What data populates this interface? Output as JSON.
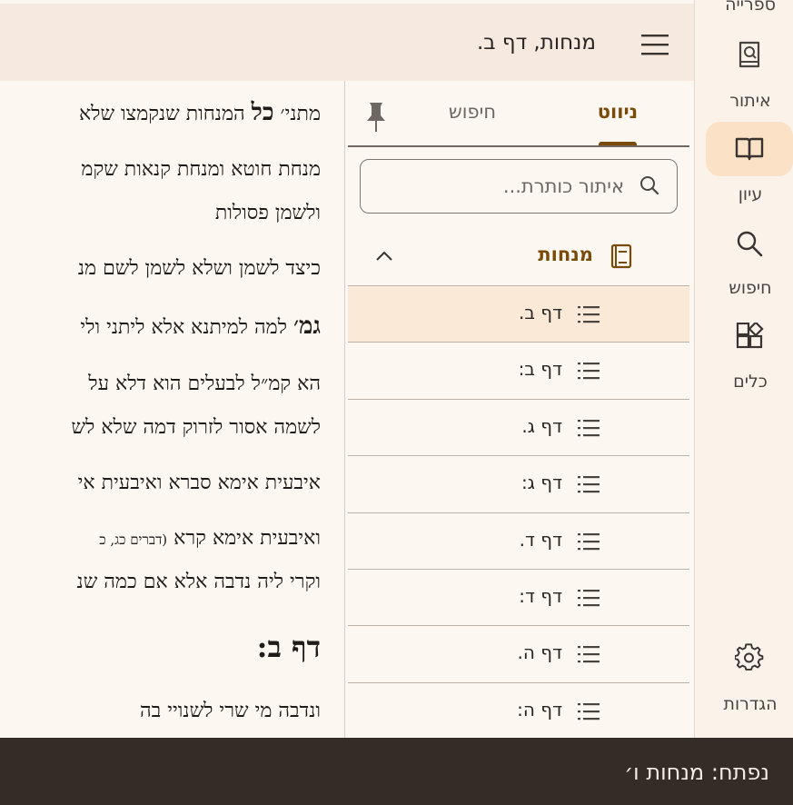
{
  "rail": {
    "items": [
      {
        "label": "ספרייה",
        "icon": "library-icon"
      },
      {
        "label": "איתור",
        "icon": "find-book-icon"
      },
      {
        "label": "עיון",
        "icon": "open-book-icon",
        "active": true
      },
      {
        "label": "חיפוש",
        "icon": "search-icon"
      },
      {
        "label": "כלים",
        "icon": "tools-icon"
      },
      {
        "label": "הגדרות",
        "icon": "settings-icon"
      }
    ]
  },
  "header": {
    "title": "מנחות, דף ב."
  },
  "sidebar": {
    "tabs": [
      {
        "label": "ניווט",
        "active": true
      },
      {
        "label": "חיפוש",
        "active": false
      }
    ],
    "search_placeholder": "איתור כותרת...",
    "book": {
      "title": "מנחות"
    },
    "toc": [
      {
        "label": "דף ב.",
        "selected": true
      },
      {
        "label": "דף ב:"
      },
      {
        "label": "דף ג."
      },
      {
        "label": "דף ג:"
      },
      {
        "label": "דף ד."
      },
      {
        "label": "דף ד:"
      },
      {
        "label": "דף ה."
      },
      {
        "label": "דף ה:"
      }
    ]
  },
  "reader": {
    "lines": [
      {
        "bold_prefix": "",
        "text": "מתני׳ ",
        "bold": "כל",
        "rest": " המנחות שנקמצו שלא"
      },
      {
        "text": "מנחת חוטא ומנחת קנאות שקמ"
      },
      {
        "text": "ולשמן פסולות"
      },
      {
        "text": "כיצד לשמן ושלא לשמן לשם מנ"
      },
      {
        "bold": "גמ׳",
        "rest": " למה למיתנא אלא ליתני ולי"
      },
      {
        "text": "הא קמ״ל לבעלים הוא דלא על"
      },
      {
        "text": "לשמה אסור לזרוק דמה שלא לש"
      },
      {
        "text": "איבעית אימא סברא ואיבעית אי"
      },
      {
        "text": "ואיבעית אימא קרא ",
        "small": "(דברים כג, כ"
      },
      {
        "text": "וקרי ליה נדבה אלא אם כמה שנ"
      },
      {
        "text": "ונדבה מי שרי לשנויי בה"
      }
    ],
    "daf_heading": "דף ב:"
  },
  "snackbar": {
    "message": "נפתח: מנחות ו׳"
  },
  "colors": {
    "accent": "#7a4a08",
    "active_pill": "#fbe1c6",
    "selected_row": "#fbe9d8",
    "header_bg": "#f6e9df",
    "snackbar_bg": "#332c27"
  }
}
